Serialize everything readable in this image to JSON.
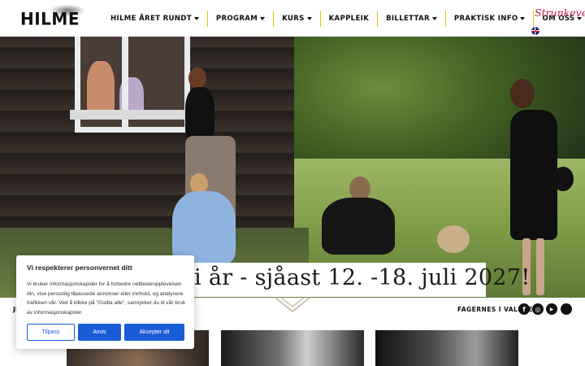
{
  "header": {
    "logo_text": "HILME",
    "nav": [
      {
        "label": "HILME ÅRET RUNDT",
        "dropdown": true
      },
      {
        "label": "PROGRAM",
        "dropdown": true
      },
      {
        "label": "KURS",
        "dropdown": true
      },
      {
        "label": "KAPPLEIK",
        "dropdown": false
      },
      {
        "label": "BILLETTAR",
        "dropdown": true
      },
      {
        "label": "PRAKTISK INFO",
        "dropdown": true
      },
      {
        "label": "OM OSS",
        "dropdown": true
      }
    ],
    "handwritten_link": "Strunkevek",
    "language_icon": "uk-flag-icon"
  },
  "hero": {
    "banner_text": "i år - sjåast 12. -18. juli 2027!"
  },
  "strip": {
    "left_text": "JI",
    "location": "FAGERNES I VALDRES",
    "social": [
      {
        "icon": "facebook-icon",
        "glyph": "f"
      },
      {
        "icon": "instagram-icon",
        "glyph": "◎"
      },
      {
        "icon": "youtube-icon",
        "glyph": "▶"
      },
      {
        "icon": "tiktok-icon",
        "glyph": ""
      }
    ]
  },
  "cookie": {
    "title": "Vi respekterer personvernet ditt",
    "body": "Vi bruker informasjonskapsler for å forbedre nettleseropplevelsen din, vise personlig tilpassede annonser eller innhold, og analysere trafikken vår. Ved å klikke på \"Godta alle\", samtykker du til vår bruk av informasjonskapsler.",
    "customize_label": "Tilpass",
    "reject_label": "Avvis",
    "accept_label": "Aksepter alt"
  },
  "colors": {
    "nav_divider": "#e9c200",
    "handwritten": "#b81a4a",
    "cookie_button": "#1a5bd6"
  }
}
